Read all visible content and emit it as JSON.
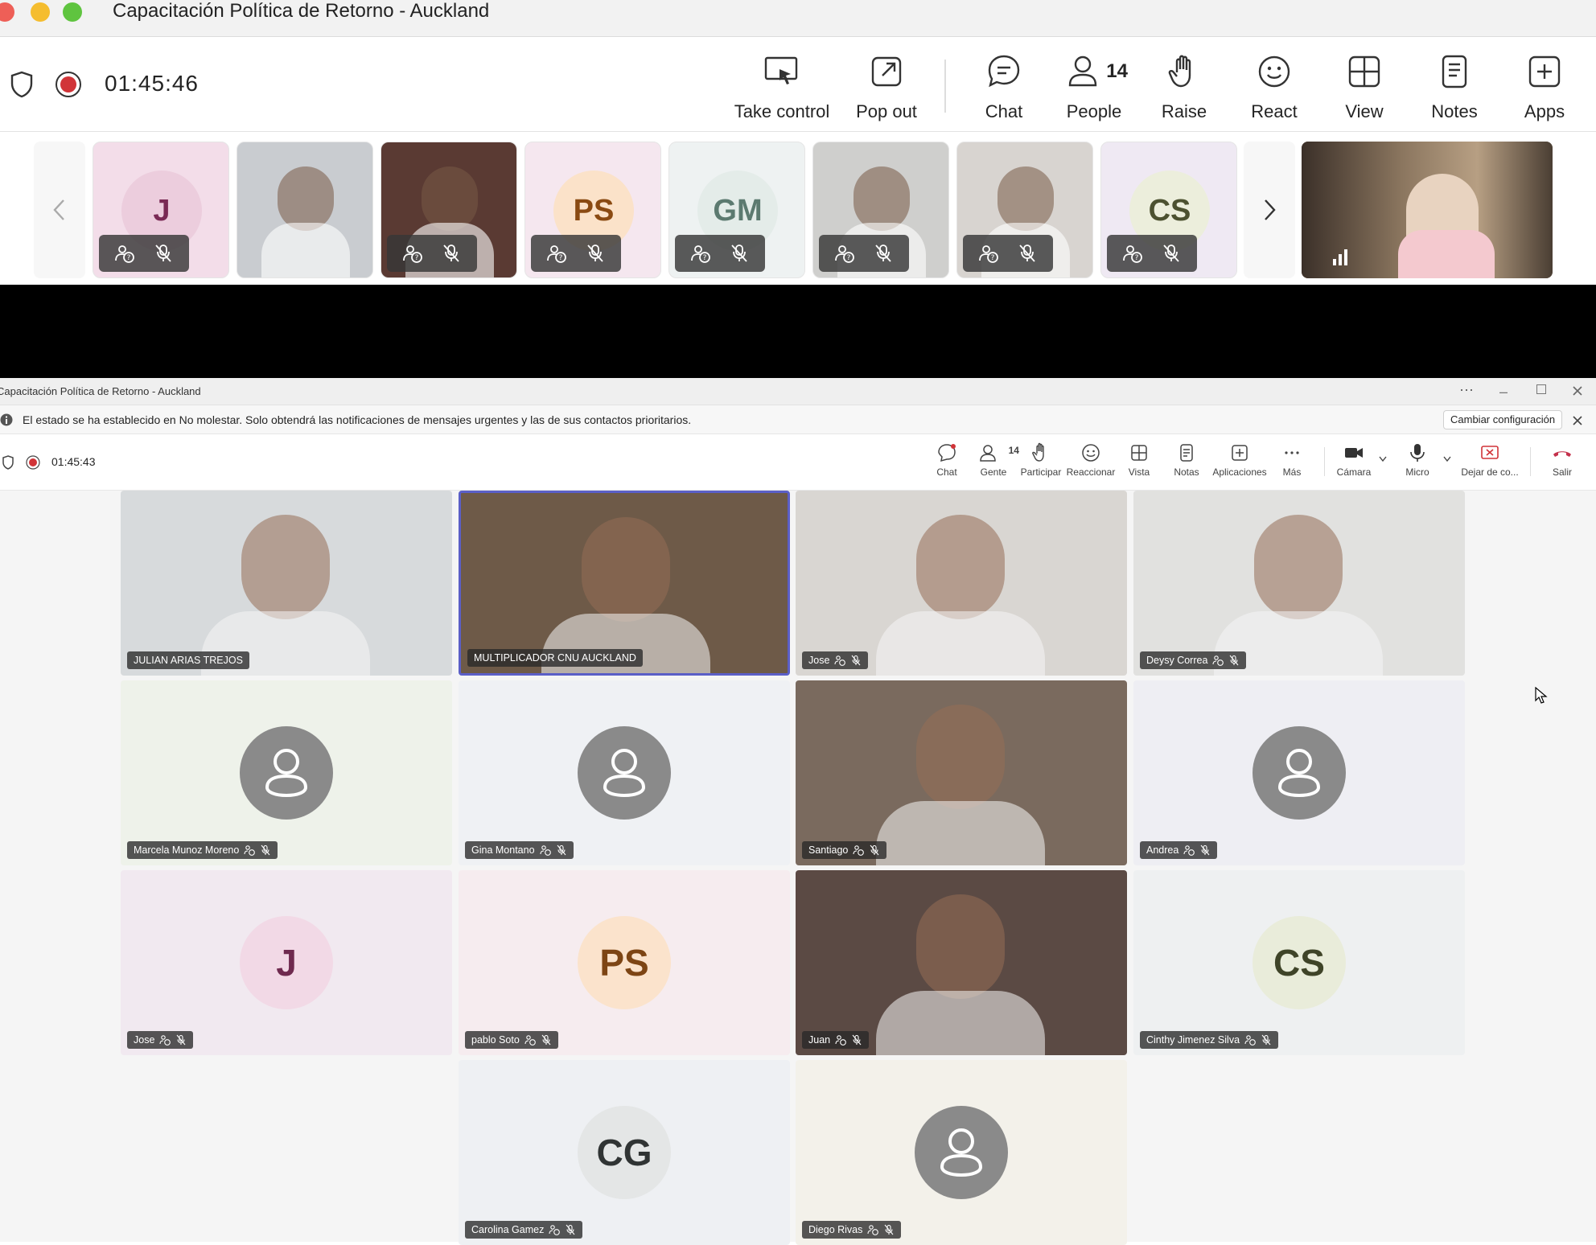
{
  "window": {
    "title": "Capacitación Política de Retorno - Auckland"
  },
  "toolbar": {
    "timer": "01:45:46",
    "take_control": "Take control",
    "pop_out": "Pop out",
    "chat": "Chat",
    "people": "People",
    "people_count": "14",
    "raise": "Raise",
    "react": "React",
    "view": "View",
    "notes": "Notes",
    "apps": "Apps"
  },
  "strip": {
    "thumbs": [
      {
        "initials": "J",
        "bg": "#f3dde9",
        "avbg": "#eccddd",
        "fg": "#7a2a55"
      },
      {
        "photo": true,
        "bg": "#c9ccd0"
      },
      {
        "photo": true,
        "bg": "#5a3a33"
      },
      {
        "initials": "PS",
        "bg": "#f5e7ef",
        "avbg": "#fbe2c9",
        "fg": "#8a4a12"
      },
      {
        "initials": "GM",
        "bg": "#eef2f2",
        "avbg": "#e4ece9",
        "fg": "#5c7a70"
      },
      {
        "photo": true,
        "bg": "#cfcfcd"
      },
      {
        "photo": true,
        "bg": "#d8d4d0"
      },
      {
        "initials": "CS",
        "bg": "#efe9f3",
        "avbg": "#eceedc",
        "fg": "#4c5130"
      }
    ]
  },
  "inner": {
    "title": "Capacitación Política de Retorno - Auckland",
    "banner_text": "El estado se ha establecido en No molestar. Solo obtendrá las notificaciones de mensajes urgentes y las de sus contactos prioritarios.",
    "banner_button": "Cambiar configuración",
    "timer": "01:45:43",
    "buttons": {
      "chat": "Chat",
      "gente": "Gente",
      "gente_count": "14",
      "participar": "Participar",
      "reaccionar": "Reaccionar",
      "vista": "Vista",
      "notas": "Notas",
      "aplicaciones": "Aplicaciones",
      "mas": "Más",
      "camara": "Cámara",
      "micro": "Micro",
      "dejar": "Dejar de co...",
      "salir": "Salir"
    }
  },
  "participants": [
    {
      "name": "JULIAN ARIAS TREJOS",
      "kind": "photo",
      "bg": "#d7dadc"
    },
    {
      "name": "MULTIPLICADOR CNU AUCKLAND",
      "kind": "photo",
      "bg": "#6e5a48"
    },
    {
      "name": "Jose",
      "kind": "photo",
      "bg": "#d9d6d2"
    },
    {
      "name": "Deysy Correa",
      "kind": "photo",
      "bg": "#e1e1df"
    },
    {
      "name": "Marcela Munoz Moreno",
      "kind": "generic",
      "bg": "#eef2ea"
    },
    {
      "name": "Gina Montano",
      "kind": "generic",
      "bg": "#eff1f4"
    },
    {
      "name": "Santiago",
      "kind": "photo",
      "bg": "#7a6a5e"
    },
    {
      "name": "Andrea",
      "kind": "generic",
      "bg": "#eeeef3"
    },
    {
      "name": "Jose",
      "kind": "initials",
      "initials": "J",
      "bg": "#f1e9f0",
      "avbg": "#f2d9e6",
      "fg": "#6f2a4f"
    },
    {
      "name": "pablo Soto",
      "kind": "initials",
      "initials": "PS",
      "bg": "#f6ecef",
      "avbg": "#fbe3cc",
      "fg": "#7d4514"
    },
    {
      "name": "Juan",
      "kind": "photo",
      "bg": "#5b4a44"
    },
    {
      "name": "Cinthy Jimenez Silva",
      "kind": "initials",
      "initials": "CS",
      "bg": "#eef0f1",
      "avbg": "#e9ecda",
      "fg": "#3f4428"
    },
    {
      "name": "Carolina Gamez",
      "kind": "initials",
      "initials": "CG",
      "bg": "#eef0f3",
      "avbg": "#e4e6e6",
      "fg": "#303434"
    },
    {
      "name": "Diego Rivas",
      "kind": "generic",
      "bg": "#f3f1ea"
    }
  ]
}
